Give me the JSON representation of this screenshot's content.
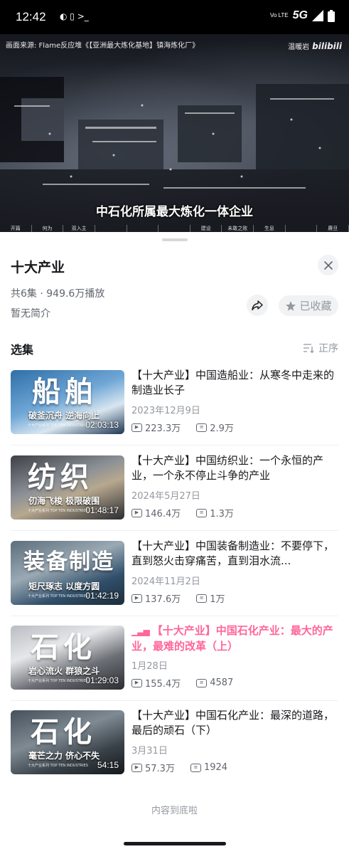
{
  "status_bar": {
    "time": "12:42",
    "network": "5G",
    "volte": "Vo LTE"
  },
  "video": {
    "source_text": "画面来源: Flame反应堆《【亚洲最大炼化基地】镇海炼化厂》",
    "watermark_author": "温暖岩",
    "watermark_brand": "bilibili",
    "subtitle": "中石化所属最大炼化一体企业",
    "chapter_labels": [
      "开篇",
      "何为",
      "双入主",
      "",
      "",
      "",
      "建设",
      "未敢之败",
      "生息",
      "",
      "赓旦"
    ]
  },
  "collection": {
    "title": "十大产业",
    "meta": "共6集 · 949.6万播放",
    "description": "暂无简介",
    "favorite_label": "已收藏"
  },
  "episodes_section": {
    "title": "选集",
    "order_label": "正序"
  },
  "episodes": [
    {
      "thumb_text": "船舶",
      "slogan": "破釜沉舟 逆海向上",
      "duration": "02:03:13",
      "title": "【十大产业】中国造船业：从寒冬中走来的制造业长子",
      "date": "2023年12月9日",
      "views": "223.3万",
      "danmaku": "2.9万",
      "active": false
    },
    {
      "thumb_text": "纺织",
      "slogan": "仞海飞梭 极限破围",
      "duration": "01:48:17",
      "title": "【十大产业】中国纺织业：一个永恒的产业，一个永不停止斗争的产业",
      "date": "2024年5月27日",
      "views": "146.4万",
      "danmaku": "1.3万",
      "active": false
    },
    {
      "thumb_text": "装备制造",
      "slogan": "矩尺琢志 以度方圆",
      "duration": "01:42:19",
      "title": "【十大产业】中国装备制造业：不要停下，直到怒火击穿痛苦，直到泪水流...",
      "date": "2024年11月2日",
      "views": "137.6万",
      "danmaku": "1万",
      "active": false
    },
    {
      "thumb_text": "石化",
      "slogan": "岩心流火 群狼之斗",
      "duration": "01:29:03",
      "title": "【十大产业】中国石化产业：最大的产业，最难的改革（上）",
      "date": "1月28日",
      "views": "155.4万",
      "danmaku": "4587",
      "active": true
    },
    {
      "thumb_text": "石化",
      "slogan": "毫芒之力 侪心不失",
      "duration": "54:15",
      "title": "【十大产业】中国石化产业：最深的道路，最后的顽石（下）",
      "date": "3月31日",
      "views": "57.3万",
      "danmaku": "1924",
      "active": false
    }
  ],
  "thumb_brand": "十大产业系列 TOP TEN INDUSTRIES",
  "footer": "内容到底啦",
  "colors": {
    "accent": "#ff6699",
    "text": "#18191c",
    "muted": "#9499a0"
  }
}
